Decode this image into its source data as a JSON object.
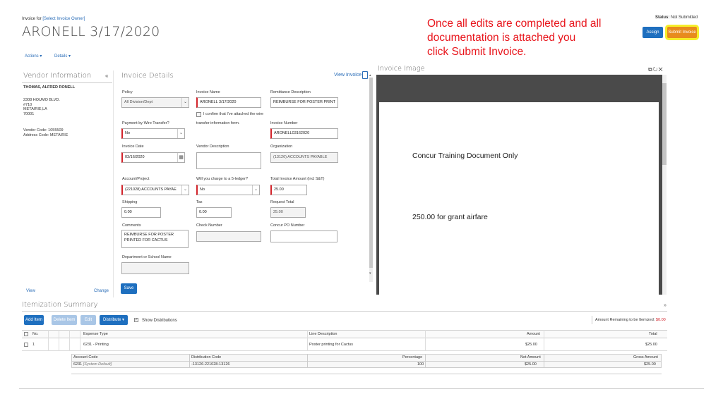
{
  "header": {
    "invoice_for_prefix": "Invoice for",
    "invoice_for_link": "[Select Invoice Owner]",
    "title": "ARONELL 3/17/2020",
    "menu_actions": "Actions",
    "menu_details": "Details",
    "status_label": "Status:",
    "status_value": "Not Submitted",
    "assign_button": "Assign",
    "submit_button": "Submit Invoice"
  },
  "annotation": {
    "line1": "Once all edits are completed and all",
    "line2": "documentation is attached you",
    "line3": "click Submit Invoice."
  },
  "vendor": {
    "section_title": "Vendor Information",
    "name": "THOMAS, ALFRED RONELL",
    "address1": "2308 HOUMO BLVD.",
    "address2": "#710",
    "address3": "METAIRIE,LA",
    "address4": "70001",
    "vendor_code": "Vendor Code: 1055509",
    "address_code": "Address Code: METAIRIE",
    "view_link": "View",
    "change_link": "Change"
  },
  "details": {
    "section_title": "Invoice Details",
    "view_invoice": "View Invoice",
    "policy_label": "Policy",
    "policy_value": "All Division/Dept",
    "invoice_name_label": "Invoice Name",
    "invoice_name_value": "ARONELL 3/17/2020",
    "remit_label": "Remittance Description",
    "remit_value": "REIMBURSE FOR POSTER PRINT",
    "wire_confirm_1": "I confirm that I've attached the wire",
    "wire_confirm_2": "transfer information form.",
    "wire_label": "Payment by Wire Transfer?",
    "wire_value": "No",
    "invoice_number_label": "Invoice Number",
    "invoice_number_value": "ARONELL03162020",
    "invoice_date_label": "Invoice Date",
    "invoice_date_value": "03/16/2020",
    "vendor_desc_label": "Vendor Description",
    "vendor_desc_value": "",
    "org_label": "Organization",
    "org_value": "(13126) ACCOUNTS PAYABLE",
    "account_label": "Account/Project",
    "account_value": "(221028) ACCOUNTS PAYAE",
    "sledger_label": "Will you charge to a 5-ledger?",
    "sledger_value": "No",
    "total_label": "Total Invoice Amount (incl S&T)",
    "total_value": "25.00",
    "shipping_label": "Shipping",
    "shipping_value": "0.00",
    "tax_label": "Tax",
    "tax_value": "0.00",
    "request_total_label": "Request Total",
    "request_total_value": "25.00",
    "comments_label": "Comments",
    "comments_line1": "REIMBURSE FOR POSTER",
    "comments_line2": "PRINTED FOR CACTUS",
    "check_number_label": "Check Number",
    "check_number_value": "",
    "concur_po_label": "Concur PO Number",
    "concur_po_value": "",
    "dept_label": "Department or School Name",
    "dept_value": "",
    "save_button": "Save"
  },
  "image_panel": {
    "title": "Invoice Image",
    "doc_line1": "Concur Training Document Only",
    "doc_line2": "250.00 for grant airfare"
  },
  "itemization": {
    "title": "Itemization Summary",
    "add_item": "Add Item",
    "delete_item": "Delete Item",
    "edit": "Edit",
    "distribute": "Distribute",
    "show_distributions": "Show Distributions",
    "remaining_label": "Amount Remaining to be Itemized:",
    "remaining_value": "$0.00",
    "headers": {
      "no": "No.",
      "expense_type": "Expense Type",
      "line_description": "Line Description",
      "amount": "Amount",
      "total": "Total"
    },
    "row": {
      "no": "1",
      "expense_type": "6231 - Printing",
      "line_description": "Poster printing for Cactus",
      "amount": "$25.00",
      "total": "$25.00"
    },
    "dist_headers": {
      "account_code": "Account Code",
      "distribution_code": "Distribution Code",
      "percentage": "Percentage",
      "net_amount": "Net Amount",
      "gross_amount": "Gross Amount"
    },
    "dist_row": {
      "account_code": "6231",
      "account_code_note": "[System Default]",
      "distribution_code": "-13126-221028-13126",
      "percentage": "100",
      "net_amount": "$25.00",
      "gross_amount": "$25.00"
    }
  }
}
